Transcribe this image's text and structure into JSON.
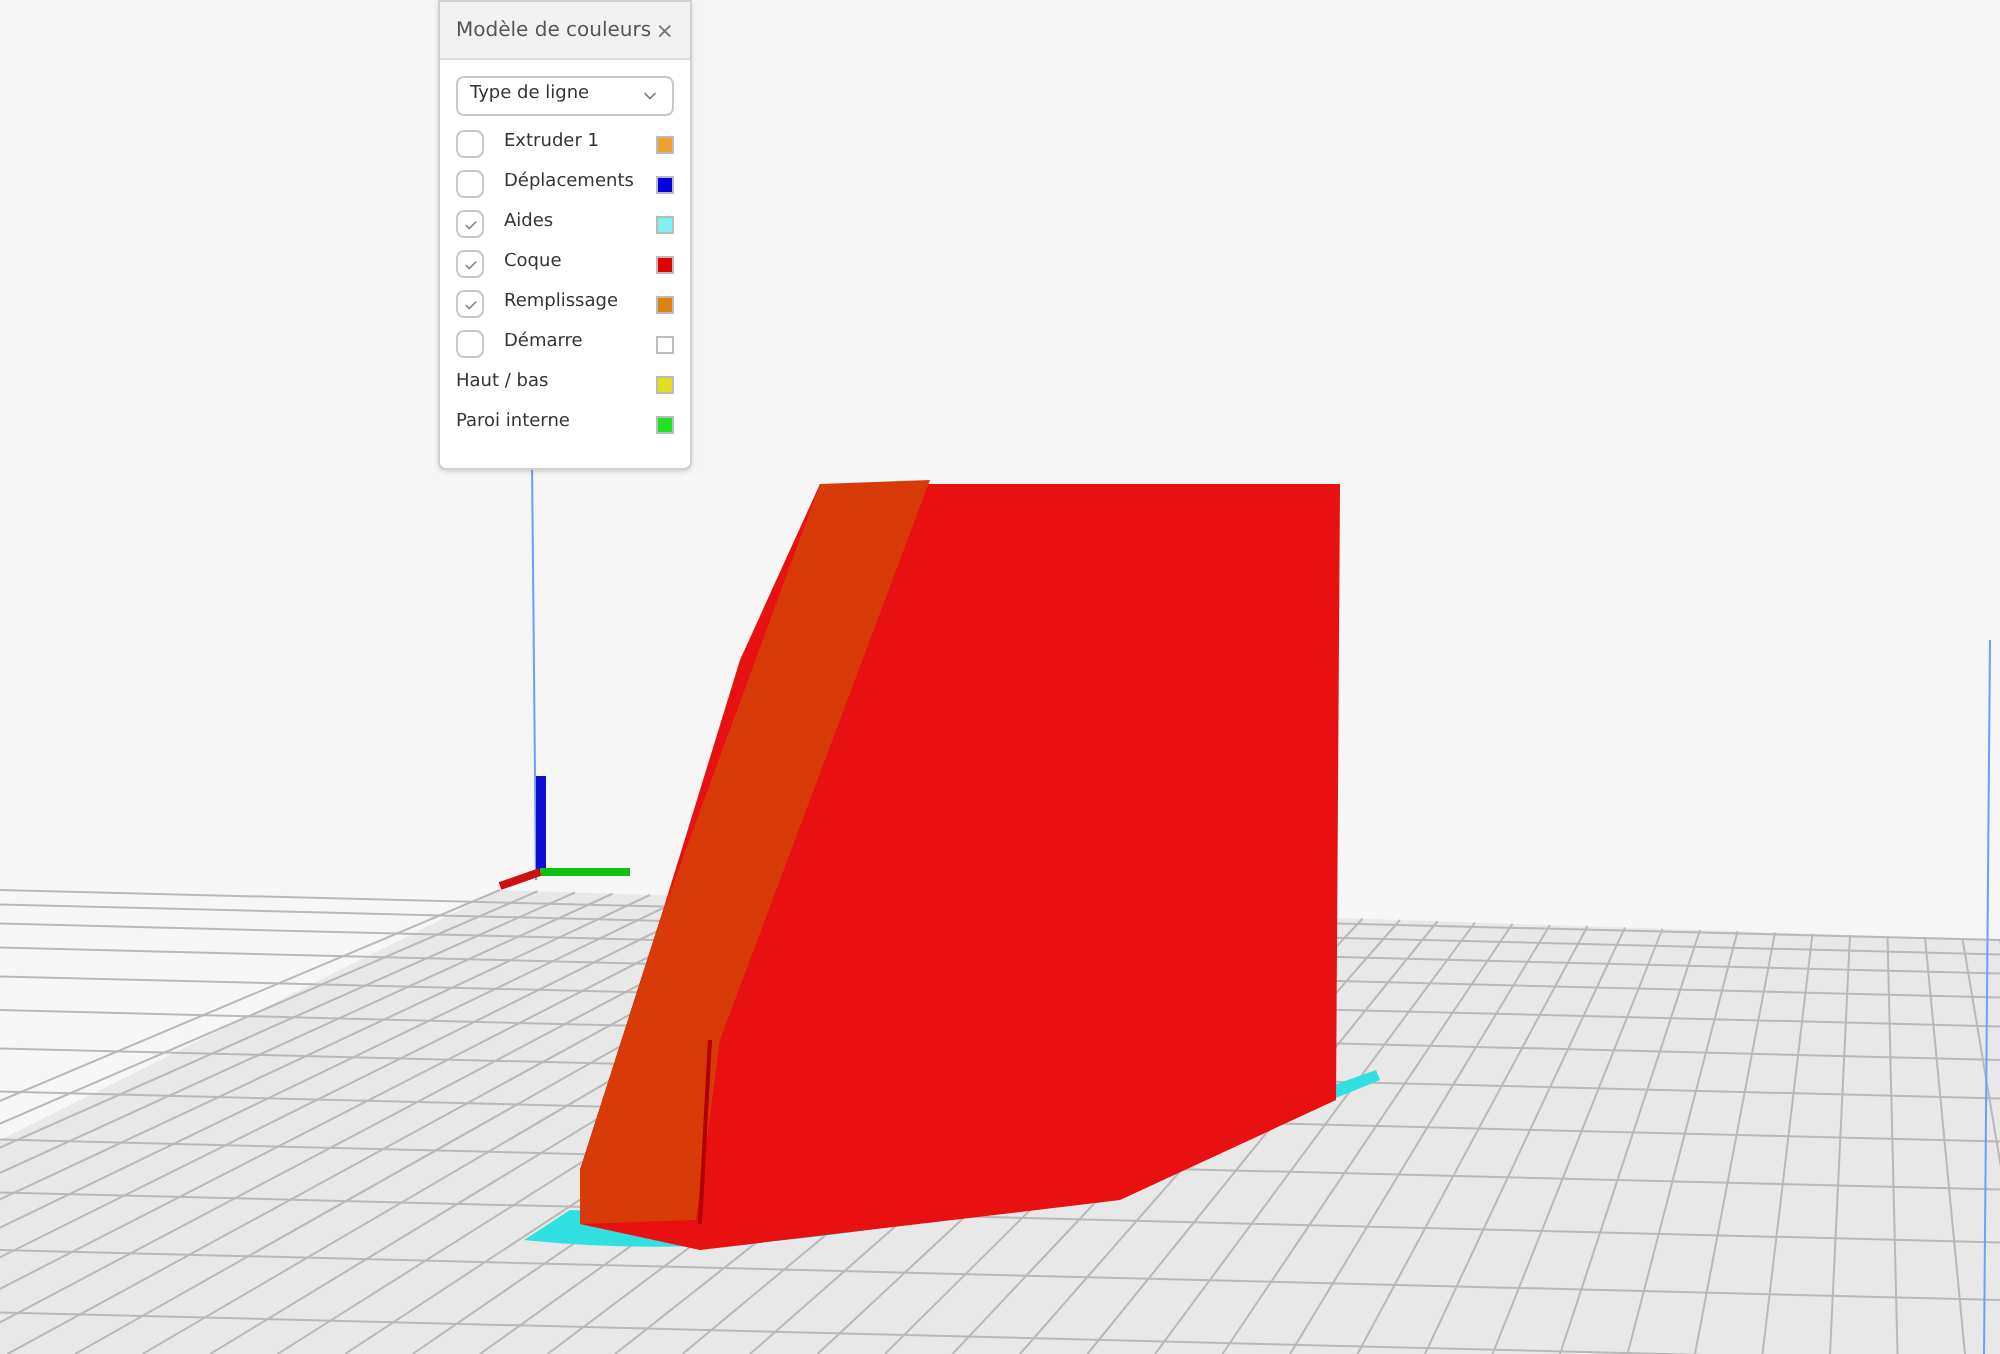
{
  "panel": {
    "title": "Modèle de couleurs",
    "close": "×",
    "dropdown": {
      "value": "Type de ligne"
    },
    "items": [
      {
        "kind": "checkbox",
        "label": "Extruder 1",
        "checked": false,
        "color": "#f0a030"
      },
      {
        "kind": "checkbox",
        "label": "Déplacements",
        "checked": false,
        "color": "#0000e0"
      },
      {
        "kind": "checkbox",
        "label": "Aides",
        "checked": true,
        "color": "#80f0f0"
      },
      {
        "kind": "checkbox",
        "label": "Coque",
        "checked": true,
        "color": "#e00000"
      },
      {
        "kind": "checkbox",
        "label": "Remplissage",
        "checked": true,
        "color": "#e08010"
      },
      {
        "kind": "checkbox",
        "label": "Démarre",
        "checked": false,
        "color": "#ffffff"
      },
      {
        "kind": "plain",
        "label": "Haut / bas",
        "color": "#e0e020"
      },
      {
        "kind": "plain",
        "label": "Paroi interne",
        "color": "#20e020"
      }
    ]
  }
}
